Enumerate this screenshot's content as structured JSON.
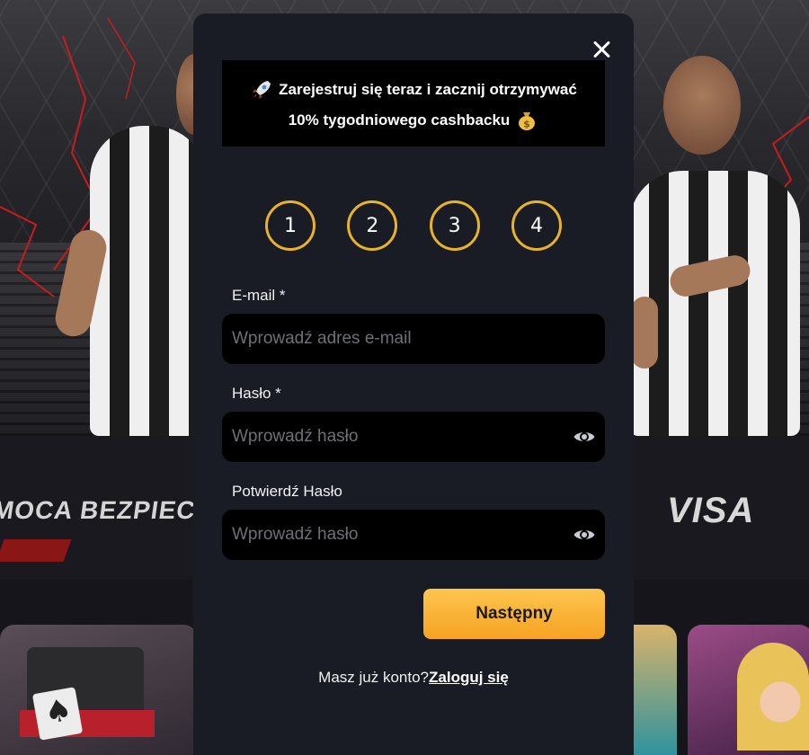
{
  "background": {
    "promo_text": "MOCA BEZPIECZ",
    "visa_logo": "VISA"
  },
  "modal": {
    "banner": {
      "line1": "Zarejestruj się teraz i zacznij otrzymywać",
      "line2": "10% tygodniowego cashbacku",
      "icons": [
        "rocket-icon",
        "money-bag-icon"
      ]
    },
    "steps": [
      "1",
      "2",
      "3",
      "4"
    ],
    "fields": {
      "email": {
        "label": "E-mail *",
        "placeholder": "Wprowadź adres e-mail",
        "value": ""
      },
      "password": {
        "label": "Hasło *",
        "placeholder": "Wprowadź hasło",
        "value": ""
      },
      "confirm_password": {
        "label": "Potwierdź Hasło",
        "placeholder": "Wprowadź hasło",
        "value": ""
      }
    },
    "next_button": "Następny",
    "login_prompt": "Masz już konto?",
    "login_link": "Zaloguj się"
  },
  "colors": {
    "modal_bg": "#191b25",
    "step_ring": "#e8b22b",
    "button_gradient_top": "#fec54f",
    "button_gradient_bottom": "#f6a322"
  }
}
